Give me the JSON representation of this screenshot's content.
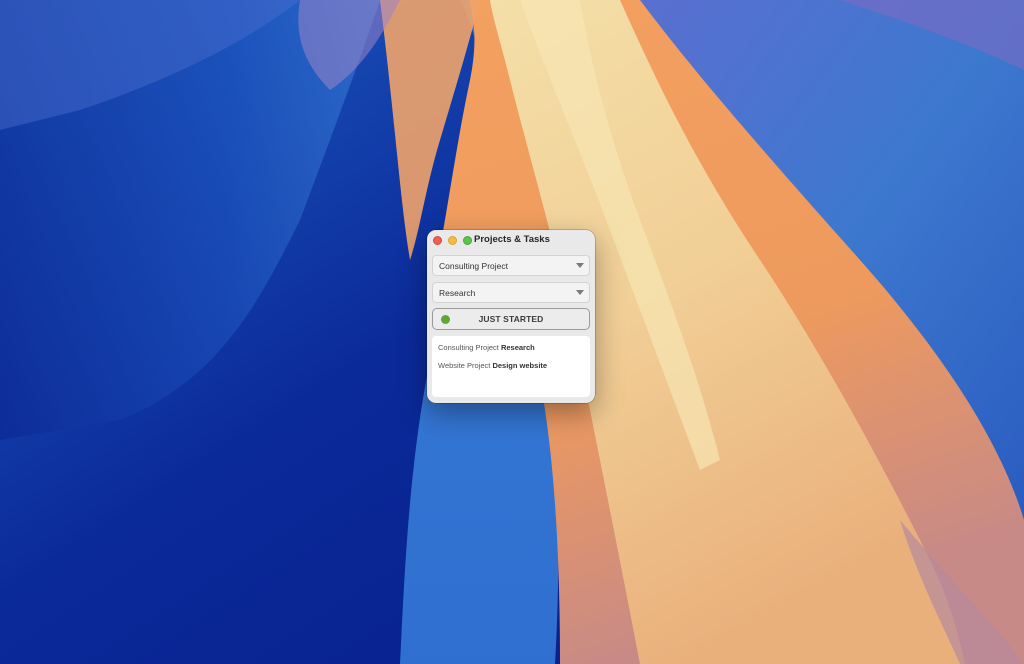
{
  "window": {
    "title": "Projects & Tasks"
  },
  "project_select": {
    "value": "Consulting Project"
  },
  "task_select": {
    "value": "Research"
  },
  "status_button": {
    "label": "JUST STARTED",
    "dot_color": "#5fa832"
  },
  "recent": [
    {
      "project": "Consulting Project",
      "task": "Research"
    },
    {
      "project": "Website Project",
      "task": "Design website"
    }
  ],
  "colors": {
    "close": "#ee5f57",
    "minimize": "#f4bd3e",
    "maximize": "#5bc549"
  }
}
